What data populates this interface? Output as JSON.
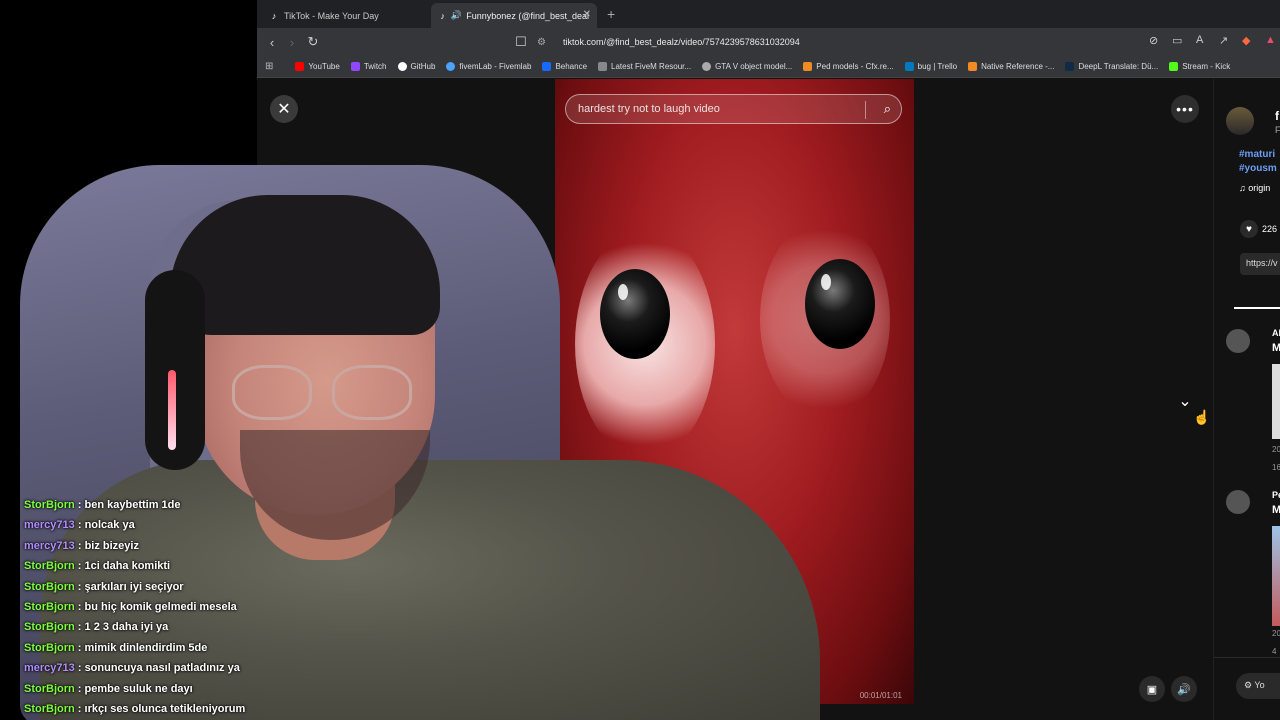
{
  "browser": {
    "tabs": [
      {
        "title": "TikTok - Make Your Day",
        "active": false
      },
      {
        "title": "Funnybonez (@find_best_deal",
        "active": true
      }
    ],
    "url": "tiktok.com/@find_best_dealz/video/7574239578631032094",
    "bookmarks": [
      {
        "label": "YouTube",
        "color": "#ff0000"
      },
      {
        "label": "Twitch",
        "color": "#9146ff"
      },
      {
        "label": "GitHub",
        "color": "#ffffff"
      },
      {
        "label": "fivemLab - Fivemlab",
        "color": "#4aa3ff"
      },
      {
        "label": "Behance",
        "color": "#1769ff"
      },
      {
        "label": "Latest FiveM Resour...",
        "color": "#888888"
      },
      {
        "label": "GTA V object model...",
        "color": "#aaaaaa"
      },
      {
        "label": "Ped models - Cfx.re...",
        "color": "#f08a24"
      },
      {
        "label": "bug | Trello",
        "color": "#0079bf"
      },
      {
        "label": "Native Reference -...",
        "color": "#f08a24"
      },
      {
        "label": "DeepL Translate: Dü...",
        "color": "#0f2b46"
      },
      {
        "label": "Stream - Kick",
        "color": "#53fc18"
      }
    ]
  },
  "tiktok": {
    "search_placeholder": "hardest try not to laugh video",
    "timecode": "00:01/01:01",
    "side": {
      "author_initial": "f",
      "author_sub": "F",
      "hashtag1": "#maturi",
      "hashtag2": "#yousm",
      "sound": "♫  origin",
      "likes": "226",
      "link": "https://v",
      "comment1_name": "Al",
      "comment1_initial": "M",
      "comment1_date": "20",
      "comment1_count": "16",
      "comment2_name": "Pe",
      "comment2_initial": "M",
      "comment2_date": "20",
      "comment2_count": "4",
      "bottom_button": "Yo"
    }
  },
  "chat": [
    {
      "user": "StorBjorn",
      "color": "#7cfc3b",
      "msg": "ben kaybettim 1de"
    },
    {
      "user": "mercy713",
      "color": "#b28cff",
      "msg": "nolcak ya"
    },
    {
      "user": "mercy713",
      "color": "#b28cff",
      "msg": "biz bizeyiz"
    },
    {
      "user": "StorBjorn",
      "color": "#7cfc3b",
      "msg": "1ci daha komikti"
    },
    {
      "user": "StorBjorn",
      "color": "#7cfc3b",
      "msg": "şarkıları iyi seçiyor"
    },
    {
      "user": "StorBjorn",
      "color": "#7cfc3b",
      "msg": "bu hiç komik gelmedi mesela"
    },
    {
      "user": "StorBjorn",
      "color": "#7cfc3b",
      "msg": "1 2 3 daha iyi ya"
    },
    {
      "user": "StorBjorn",
      "color": "#7cfc3b",
      "msg": "mimik dinlendirdim 5de"
    },
    {
      "user": "mercy713",
      "color": "#b28cff",
      "msg": "sonuncuya nasıl patladınız ya"
    },
    {
      "user": "StorBjorn",
      "color": "#7cfc3b",
      "msg": "pembe suluk ne dayı"
    },
    {
      "user": "StorBjorn",
      "color": "#7cfc3b",
      "msg": "ırkçı ses olunca tetikleniyorum"
    }
  ]
}
